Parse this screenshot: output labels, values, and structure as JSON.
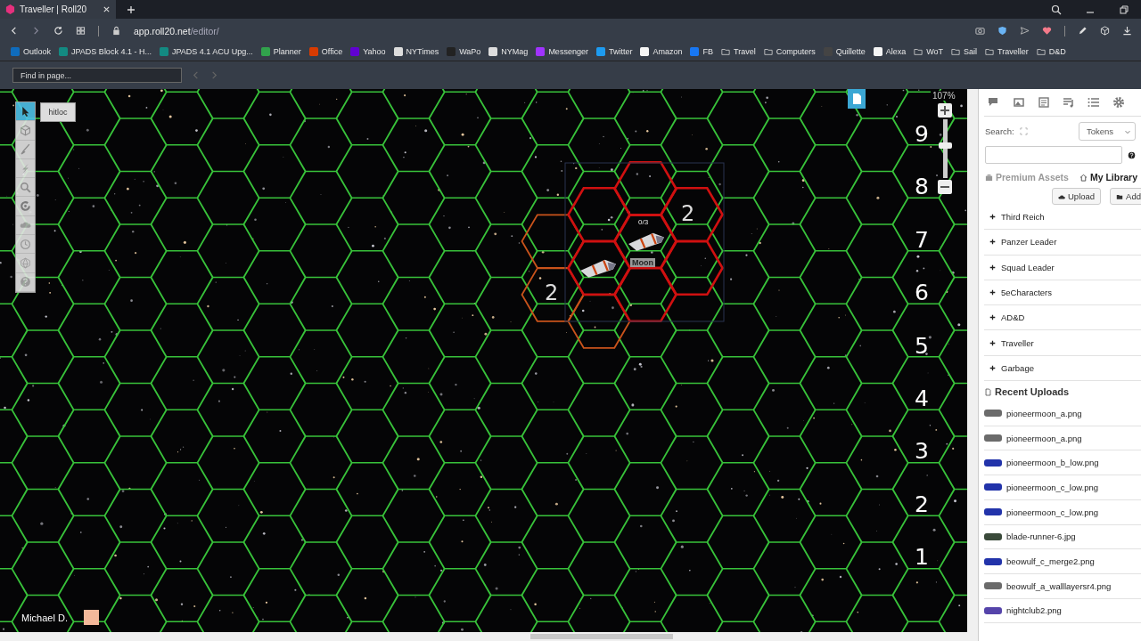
{
  "browser": {
    "tab_title": "Traveller | Roll20",
    "url_host": "app.roll20.net",
    "url_path": "/editor/",
    "bookmarks": [
      {
        "label": "Outlook",
        "kind": "site",
        "color": "#0f6cbd"
      },
      {
        "label": "JPADS Block 4.1 - H...",
        "kind": "site",
        "color": "#138a82"
      },
      {
        "label": "JPADS 4.1 ACU Upg...",
        "kind": "site",
        "color": "#138a82"
      },
      {
        "label": "Planner",
        "kind": "site",
        "color": "#31a24c"
      },
      {
        "label": "Office",
        "kind": "site",
        "color": "#d83b01"
      },
      {
        "label": "Yahoo",
        "kind": "site",
        "color": "#6001d2"
      },
      {
        "label": "NYTimes",
        "kind": "site",
        "color": "#dddddd"
      },
      {
        "label": "WaPo",
        "kind": "site",
        "color": "#222222"
      },
      {
        "label": "NYMag",
        "kind": "site",
        "color": "#dddddd"
      },
      {
        "label": "Messenger",
        "kind": "site",
        "color": "#a033ff"
      },
      {
        "label": "Twitter",
        "kind": "site",
        "color": "#1d9bf0"
      },
      {
        "label": "Amazon",
        "kind": "site",
        "color": "#f5f5f5"
      },
      {
        "label": "FB",
        "kind": "site",
        "color": "#1877f2"
      },
      {
        "label": "Travel",
        "kind": "folder"
      },
      {
        "label": "Computers",
        "kind": "folder"
      },
      {
        "label": "Quillette",
        "kind": "site",
        "color": "#444444"
      },
      {
        "label": "Alexa",
        "kind": "site",
        "color": "#f5f5f5"
      },
      {
        "label": "WoT",
        "kind": "folder"
      },
      {
        "label": "Sail",
        "kind": "folder"
      },
      {
        "label": "Traveller",
        "kind": "folder"
      },
      {
        "label": "D&D",
        "kind": "folder"
      }
    ],
    "find_placeholder": "Find in page..."
  },
  "toolbar": {
    "tools": [
      {
        "kind": "select",
        "selected": true
      },
      {
        "kind": "layer",
        "selected": false
      },
      {
        "kind": "draw",
        "selected": false
      },
      {
        "kind": "fx",
        "selected": false
      },
      {
        "kind": "zoom",
        "selected": false
      },
      {
        "kind": "measure",
        "selected": false
      },
      {
        "kind": "fog",
        "selected": false
      },
      {
        "kind": "turn",
        "selected": false
      },
      {
        "kind": "dice",
        "selected": false
      },
      {
        "kind": "help",
        "selected": false
      }
    ],
    "macro_label": "hitloc"
  },
  "map": {
    "zoom_reading": "107%",
    "zoom": {
      "level": 0.6
    },
    "row_labels": [
      "9",
      "8",
      "7",
      "6",
      "5",
      "4",
      "3",
      "2",
      "1"
    ],
    "tokens": [
      {
        "name": "Moon",
        "bar": "0/3"
      }
    ],
    "range_labels": [
      "2",
      "2"
    ],
    "player": {
      "name": "Michael D.",
      "color": "#f4b89a"
    }
  },
  "sidebar": {
    "search_label": "Search:",
    "source": "Tokens",
    "library_tabs": [
      {
        "label": "Premium Assets",
        "selected": false
      },
      {
        "label": "My Library",
        "selected": true
      }
    ],
    "buttons": [
      "Upload",
      "Add"
    ],
    "folders": [
      "Third Reich",
      "Panzer Leader",
      "Squad Leader",
      "5eCharacters",
      "AD&D",
      "Traveller",
      "Garbage"
    ],
    "recent_heading": "Recent Uploads",
    "uploads": [
      {
        "name": "pioneermoon_a.png",
        "color": "#6b6b6b"
      },
      {
        "name": "pioneermoon_a.png",
        "color": "#6b6b6b"
      },
      {
        "name": "pioneermoon_b_low.png",
        "color": "#2233aa"
      },
      {
        "name": "pioneermoon_c_low.png",
        "color": "#2233aa"
      },
      {
        "name": "pioneermoon_c_low.png",
        "color": "#2233aa"
      },
      {
        "name": "blade-runner-6.jpg",
        "color": "#3a4a3a"
      },
      {
        "name": "beowulf_c_merge2.png",
        "color": "#2233aa"
      },
      {
        "name": "beowulf_a_walllayersr4.png",
        "color": "#6b6b6b"
      },
      {
        "name": "nightclub2.png",
        "color": "#5544aa"
      }
    ]
  }
}
